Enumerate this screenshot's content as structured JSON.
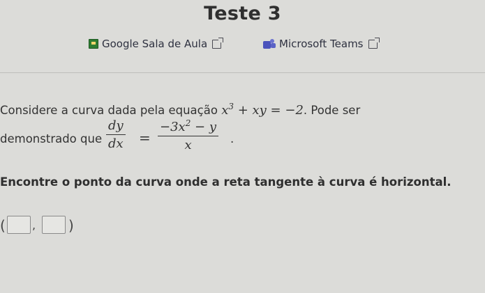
{
  "page": {
    "title": "Teste 3"
  },
  "links": [
    {
      "label": "Google Sala de Aula",
      "icon": "google-classroom-icon",
      "external_icon": "external-link-icon"
    },
    {
      "label": "Microsoft Teams",
      "icon": "microsoft-teams-icon",
      "external_icon": "external-link-icon"
    }
  ],
  "problem": {
    "intro": "Considere a curva dada pela equação",
    "equation_base": "x",
    "equation_exp": "3",
    "equation_rest": " + xy = −2",
    "intro_end": ". Pode ser",
    "line2_text": "demonstrado que",
    "dy": "dy",
    "dx": "dx",
    "equals": "=",
    "rhs_num_a": "−3x",
    "rhs_num_exp": "2",
    "rhs_num_b": " − y",
    "rhs_den": "x",
    "line2_end": ".",
    "question": "Encontre o ponto da curva onde a reta tangente à curva é horizontal."
  },
  "answer": {
    "open": "(",
    "separator": ",",
    "close": ")",
    "x_value": "",
    "y_value": ""
  },
  "colors": {
    "background": "#dcdcd9",
    "text": "#333333",
    "classroom_green": "#2e7d32",
    "teams_purple": "#4b53bc"
  }
}
